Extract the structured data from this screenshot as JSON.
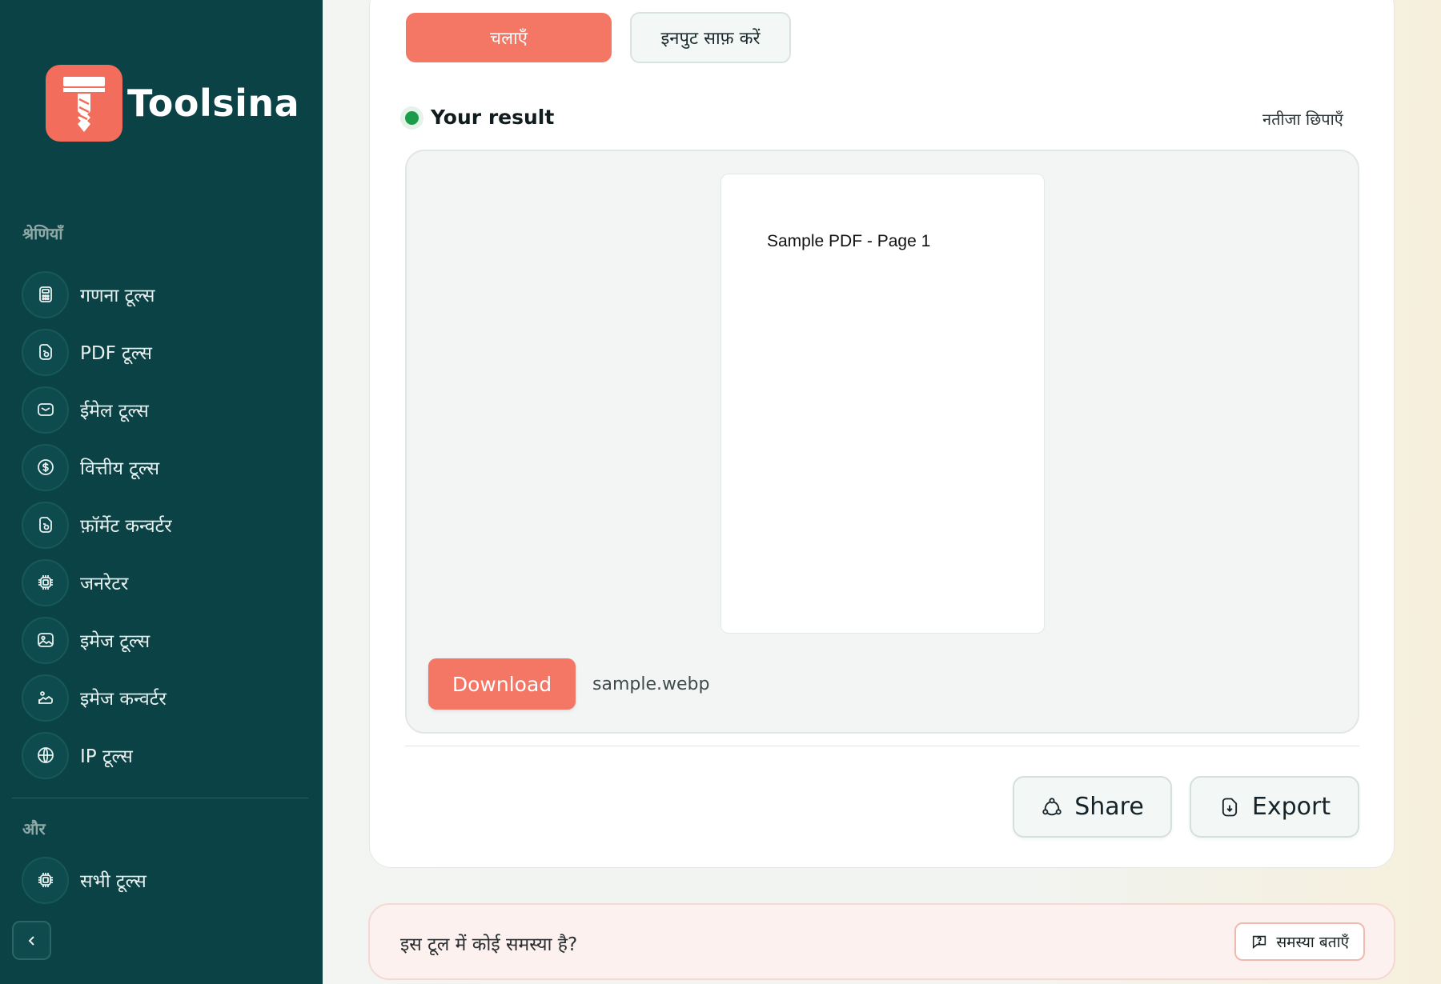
{
  "brand": {
    "name": "Toolsina",
    "accent": "#f26d5b",
    "sidebar_bg": "#0b4246"
  },
  "sidebar": {
    "categories_heading": "श्रेणियाँ",
    "items": [
      {
        "label": "गणना टूल्स",
        "icon": "calculator-icon"
      },
      {
        "label": "PDF टूल्स",
        "icon": "document-icon"
      },
      {
        "label": "ईमेल टूल्स",
        "icon": "mail-icon"
      },
      {
        "label": "वित्तीय टूल्स",
        "icon": "dollar-icon"
      },
      {
        "label": "फ़ॉर्मेट कन्वर्टर",
        "icon": "document-icon"
      },
      {
        "label": "जनरेटर",
        "icon": "chip-icon"
      },
      {
        "label": "इमेज टूल्स",
        "icon": "image-icon"
      },
      {
        "label": "इमेज कन्वर्टर",
        "icon": "image-convert-icon"
      },
      {
        "label": "IP टूल्स",
        "icon": "globe-icon"
      }
    ],
    "more_heading": "और",
    "more_items": [
      {
        "label": "सभी टूल्स",
        "icon": "chip-icon"
      }
    ],
    "collapse_icon": "chevron-left-icon"
  },
  "actions": {
    "run_label": "चलाएँ",
    "clear_label": "इनपुट साफ़ करें"
  },
  "result": {
    "title": "Your result",
    "hide_label": "नतीजा छिपाएँ",
    "preview_text": "Sample PDF - Page 1",
    "download_label": "Download",
    "file_name": "sample.webp",
    "status_color": "#1a9c4b"
  },
  "footer_actions": {
    "share_label": "Share",
    "export_label": "Export"
  },
  "problem": {
    "text": "इस टूल में कोई समस्या है?",
    "report_label": "समस्या बताएँ"
  }
}
